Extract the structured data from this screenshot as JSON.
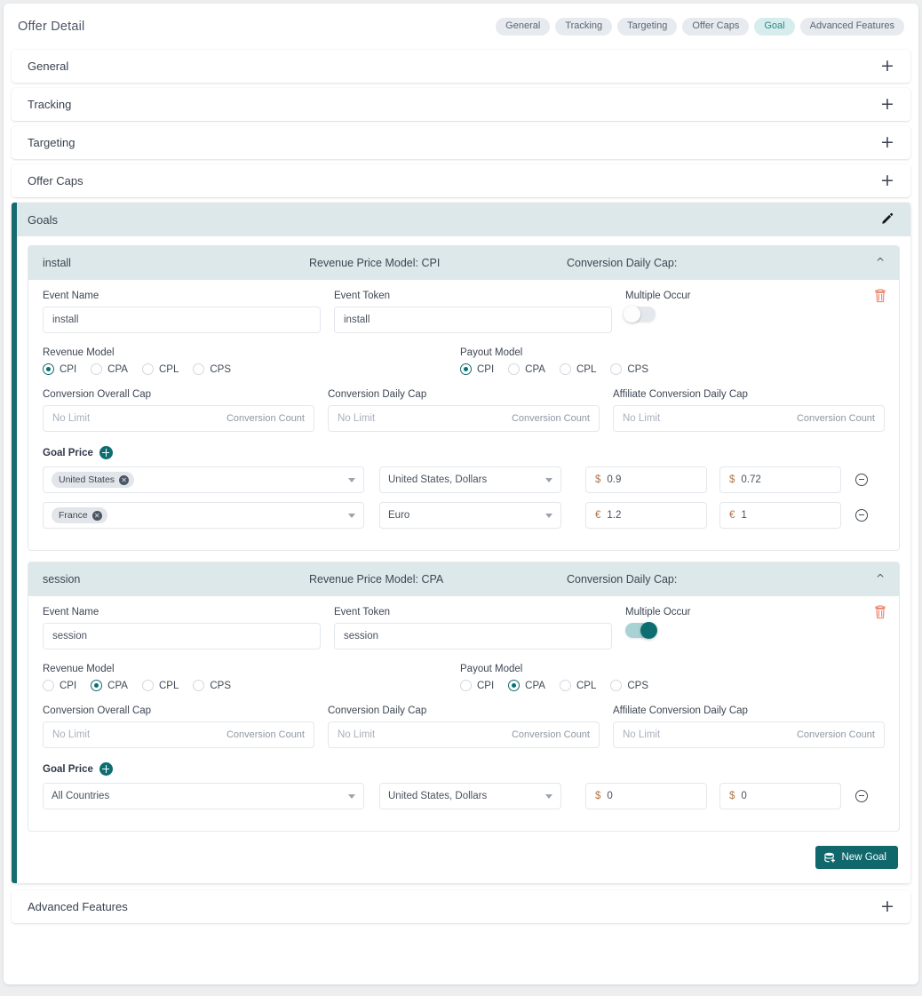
{
  "header": {
    "title": "Offer Detail",
    "chips": [
      {
        "label": "General",
        "active": false
      },
      {
        "label": "Tracking",
        "active": false
      },
      {
        "label": "Targeting",
        "active": false
      },
      {
        "label": "Offer Caps",
        "active": false
      },
      {
        "label": "Goal",
        "active": true
      },
      {
        "label": "Advanced Features",
        "active": false
      }
    ]
  },
  "accordions": {
    "general": "General",
    "tracking": "Tracking",
    "targeting": "Targeting",
    "offer_caps": "Offer Caps",
    "advanced_features": "Advanced Features"
  },
  "goals_section": {
    "title": "Goals",
    "edit_icon": "pencil-icon",
    "new_goal_button": "New Goal",
    "new_goal_icon": "database-plus-icon"
  },
  "labels": {
    "event_name": "Event Name",
    "event_token": "Event Token",
    "multiple_occur": "Multiple Occur",
    "revenue_model": "Revenue Model",
    "payout_model": "Payout Model",
    "conversion_overall_cap": "Conversion Overall Cap",
    "conversion_daily_cap": "Conversion Daily Cap",
    "affiliate_conversion_daily_cap": "Affiliate Conversion Daily Cap",
    "goal_price": "Goal Price",
    "no_limit_placeholder": "No Limit",
    "conversion_count_suffix": "Conversion Count",
    "all_countries_placeholder": "All Countries"
  },
  "model_options": [
    "CPI",
    "CPA",
    "CPL",
    "CPS"
  ],
  "colors": {
    "accent_teal": "#0d6e72",
    "header_band": "#dde8ea",
    "chip_active_bg": "#d7ecec",
    "chip_active_text": "#2b8a8a",
    "trash_red": "#f08a72",
    "currency_symbol": "#b1754a",
    "page_bg": "#eceef0"
  },
  "goals": [
    {
      "name": "install",
      "revenue_price_model": "Revenue Price Model: CPI",
      "conversion_daily_cap_summary": "Conversion Daily Cap:",
      "expanded": true,
      "event_name": "install",
      "event_token": "install",
      "multiple_occur": false,
      "revenue_model_selected": "CPI",
      "payout_model_selected": "CPI",
      "conversion_overall_cap": "",
      "conversion_daily_cap": "",
      "affiliate_conversion_daily_cap": "",
      "prices": [
        {
          "country": "United States",
          "country_placeholder": "",
          "currency": "United States, Dollars",
          "symbol": "$",
          "revenue": "0.9",
          "payout": "0.72"
        },
        {
          "country": "France",
          "country_placeholder": "",
          "currency": "Euro",
          "symbol": "€",
          "revenue": "1.2",
          "payout": "1"
        }
      ]
    },
    {
      "name": "session",
      "revenue_price_model": "Revenue Price Model: CPA",
      "conversion_daily_cap_summary": "Conversion Daily Cap:",
      "expanded": true,
      "event_name": "session",
      "event_token": "session",
      "multiple_occur": true,
      "revenue_model_selected": "CPA",
      "payout_model_selected": "CPA",
      "conversion_overall_cap": "",
      "conversion_daily_cap": "",
      "affiliate_conversion_daily_cap": "",
      "prices": [
        {
          "country": "",
          "country_placeholder": "All Countries",
          "currency": "United States, Dollars",
          "symbol": "$",
          "revenue": "0",
          "payout": "0"
        }
      ]
    }
  ]
}
